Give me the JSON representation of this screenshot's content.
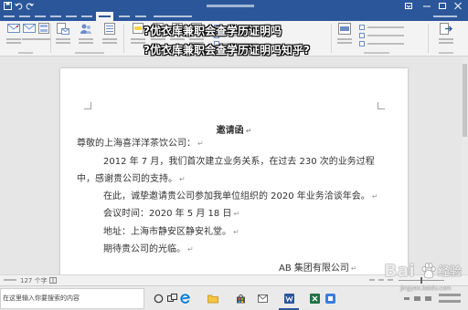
{
  "colors": {
    "word_blue": "#2b579a",
    "ribbon_bg": "#f3f3f3",
    "document_bg": "#e6e6e6",
    "page_bg": "#ffffff",
    "overlay_text": "#ffffff",
    "excel_green": "#217346",
    "edge_blue": "#0078d7",
    "folder_yellow": "#f4c542"
  },
  "title_bar": {
    "quick_access_icons": [
      "save-icon",
      "undo-icon",
      "redo-icon"
    ],
    "window_controls": [
      "minimize-icon",
      "maximize-icon",
      "close-icon"
    ]
  },
  "ribbon": {
    "icons": [
      "chinese-envelope-icon",
      "envelope-icon",
      "label-icon",
      "mail-merge-icon",
      "recipients-icon",
      "edit-list-icon",
      "highlight-icon",
      "address-block-icon",
      "greeting-icon",
      "merge-field-icon",
      "preview-icon",
      "finish-merge-icon"
    ]
  },
  "overlay": {
    "line1": "?优衣库兼职会查学历证明吗",
    "line2": "?优衣库兼职会查学历证明吗知乎?"
  },
  "document": {
    "title": "邀请函",
    "salutation": "尊敬的上海喜洋洋茶饮公司：",
    "para1_line1": "2012 年 7 月，我们首次建立业务关系，在过去 230 次的业务过程",
    "para1_line2": "中，感谢贵公司的支持。",
    "para2": "在此，诚挚邀请贵公司参加我单位组织的 2020 年业务洽谈年会。",
    "meeting_time": "会议时间：2020 年 5 月 18 日",
    "address": "地址：上海市静安区静安礼堂。",
    "closing": "期待贵公司的光临。",
    "signature": "AB 集团有限公司",
    "paragraph_mark": "↵"
  },
  "status_bar": {
    "word_count": "127 个字"
  },
  "taskbar": {
    "search_placeholder": "在这里输入你要搜索的内容",
    "app_icons": [
      "cortana-icon",
      "task-view-icon",
      "edge-icon",
      "file-explorer-icon",
      "store-icon",
      "app-icon",
      "word-icon",
      "excel-icon",
      "app-icon"
    ]
  },
  "watermark": {
    "brand": "Bai",
    "product": "经验",
    "url": "jingyan.baidu.com",
    "logo_icon": "paw-icon"
  }
}
